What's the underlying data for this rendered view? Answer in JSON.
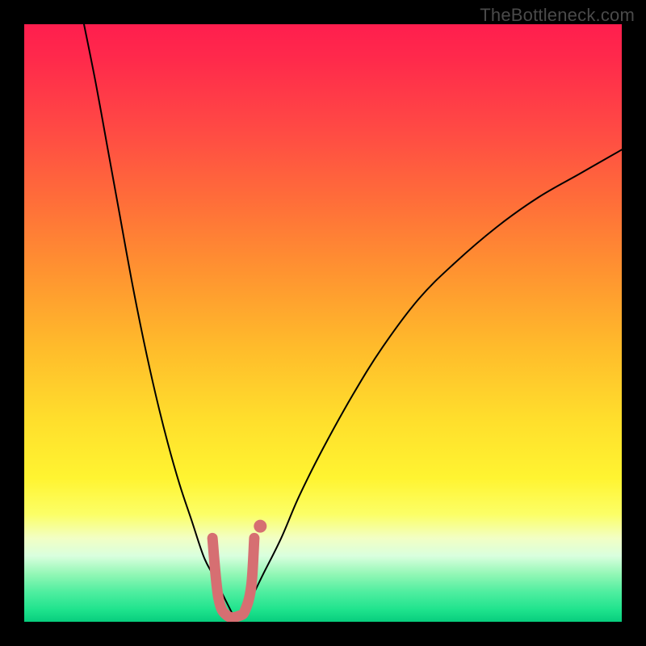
{
  "watermark": "TheBottleneck.com",
  "chart_data": {
    "type": "line",
    "title": "",
    "xlabel": "",
    "ylabel": "",
    "xlim": [
      0,
      100
    ],
    "ylim": [
      0,
      100
    ],
    "grid": false,
    "legend": false,
    "series": [
      {
        "name": "left-curve",
        "x": [
          10,
          12,
          14,
          16,
          18,
          20,
          22,
          24,
          26,
          28,
          30,
          31.5,
          33,
          34,
          35
        ],
        "y": [
          100,
          90,
          79,
          68,
          57,
          47,
          38,
          30,
          23,
          17,
          11,
          8,
          5,
          3,
          1
        ]
      },
      {
        "name": "right-curve",
        "x": [
          36,
          38,
          40,
          43,
          46,
          50,
          55,
          60,
          66,
          72,
          79,
          86,
          93,
          100
        ],
        "y": [
          1,
          4,
          8,
          14,
          21,
          29,
          38,
          46,
          54,
          60,
          66,
          71,
          75,
          79
        ]
      },
      {
        "name": "optimal-marker",
        "x": [
          31.5,
          32.5,
          34,
          36,
          37,
          38,
          38.5
        ],
        "y": [
          14,
          4,
          1,
          1,
          2,
          6,
          14
        ]
      }
    ],
    "annotations": [
      {
        "type": "dot",
        "x": 39.5,
        "y": 16
      }
    ],
    "colors": {
      "curve": "#000000",
      "marker": "#d66f72",
      "gradient_top": "#ff1e4e",
      "gradient_mid": "#ffde2c",
      "gradient_bottom": "#07cd7d"
    }
  }
}
